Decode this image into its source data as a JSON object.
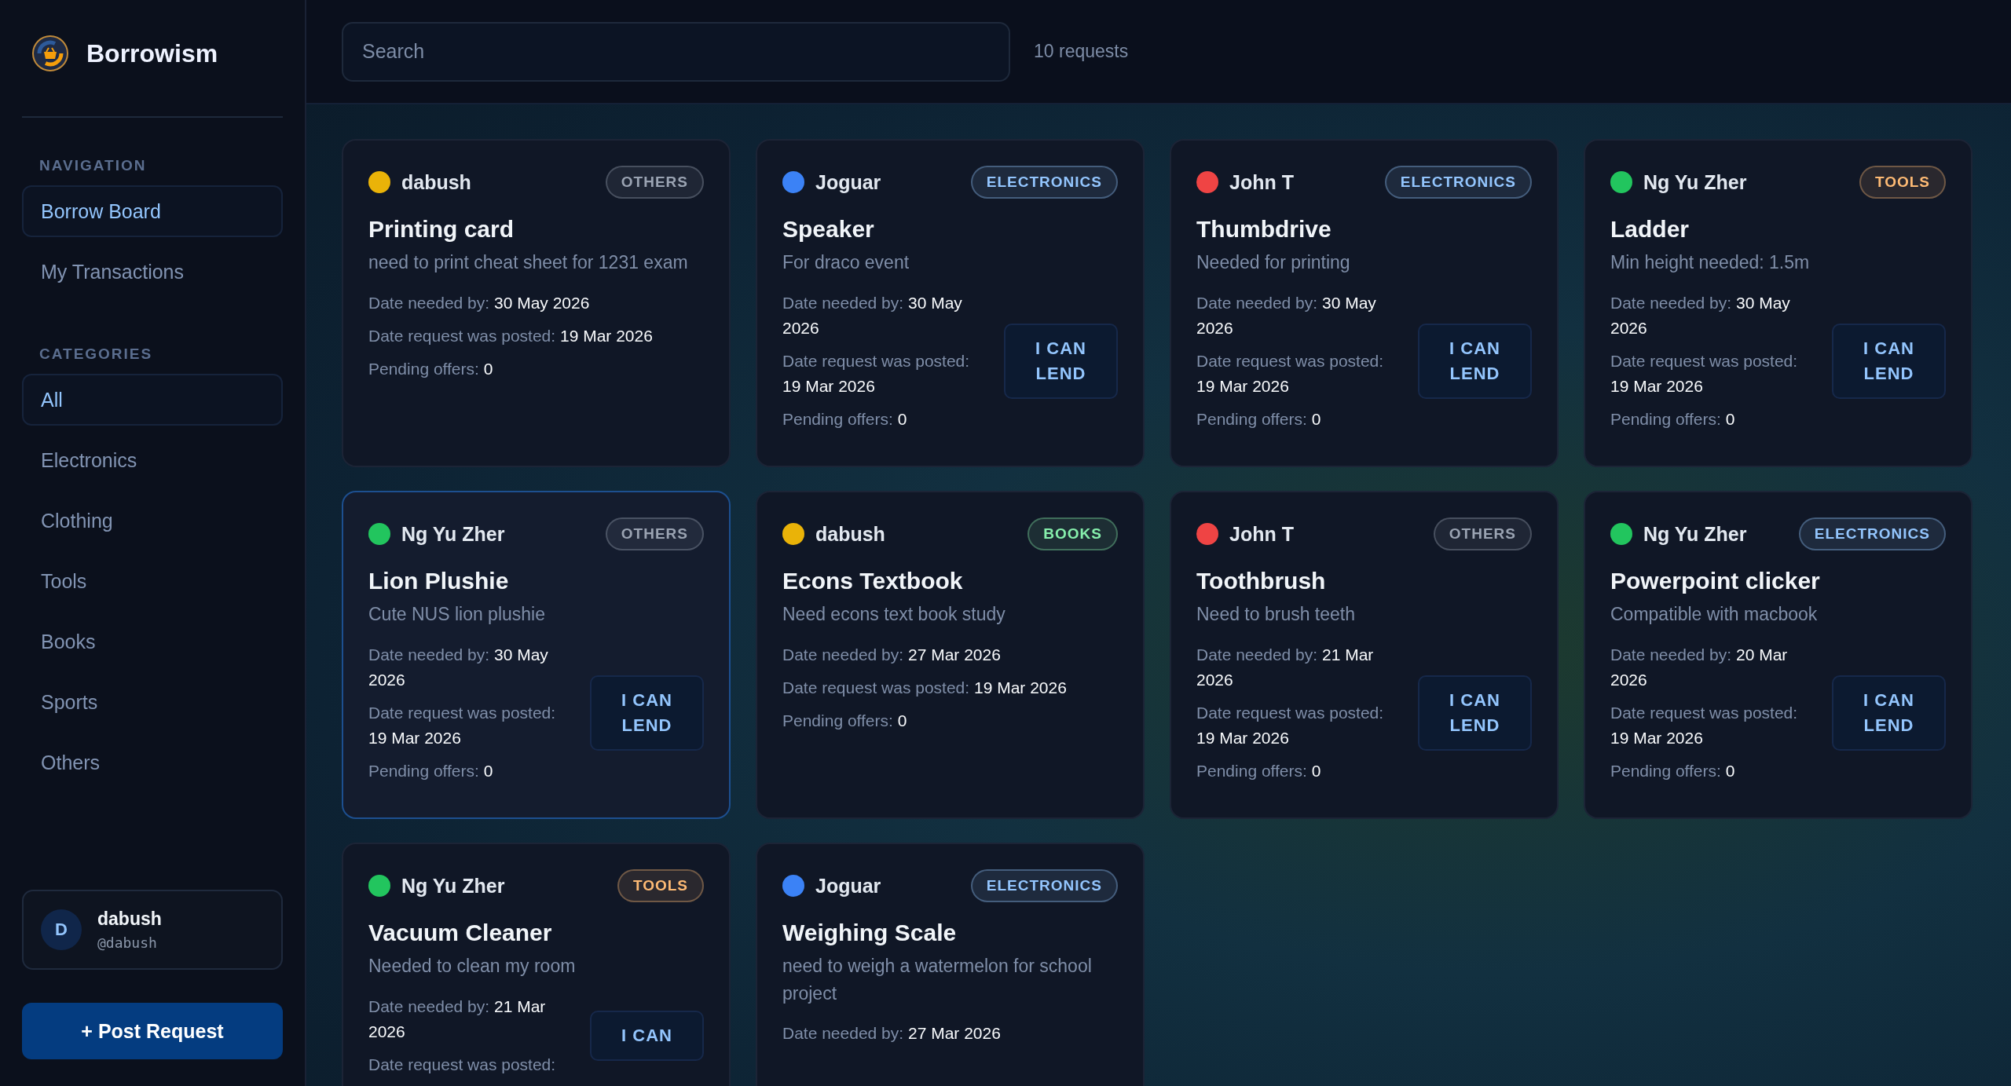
{
  "app": {
    "name": "Borrowism"
  },
  "sidebar": {
    "sections": [
      {
        "heading": "NAVIGATION",
        "items": [
          {
            "label": "Borrow Board",
            "selected": true
          },
          {
            "label": "My Transactions",
            "selected": false
          }
        ]
      },
      {
        "heading": "CATEGORIES",
        "items": [
          {
            "label": "All",
            "selected": true
          },
          {
            "label": "Electronics",
            "selected": false
          },
          {
            "label": "Clothing",
            "selected": false
          },
          {
            "label": "Tools",
            "selected": false
          },
          {
            "label": "Books",
            "selected": false
          },
          {
            "label": "Sports",
            "selected": false
          },
          {
            "label": "Others",
            "selected": false
          }
        ]
      }
    ],
    "user": {
      "initial": "D",
      "name": "dabush",
      "handle": "@dabush"
    },
    "post_button": "+ Post Request"
  },
  "search": {
    "placeholder": "Search"
  },
  "count": "10 requests",
  "requests": [
    {
      "user": "dabush",
      "color": "#eab308",
      "tag": {
        "label": "OTHERS",
        "color": "#9aa3b2"
      },
      "title": "Printing card",
      "description": "need to print cheat sheet for 1231 exam",
      "details": [
        "Date needed by: **30 May 2026**",
        "Date request was posted: **19 Mar 2026**",
        "Pending offers: **0**"
      ],
      "highlighted": false
    },
    {
      "user": "Joguar",
      "color": "#3b82f6",
      "tag": {
        "label": "ELECTRONICS",
        "color": "#93c5fd"
      },
      "title": "Speaker",
      "description": "For draco event",
      "details": [
        "Date needed by: **30 May 2026**",
        "Date request was posted: **19 Mar 2026**",
        "Pending offers: **0**"
      ],
      "lend_label": "I CAN LEND",
      "highlighted": false
    },
    {
      "user": "John T",
      "color": "#ef4444",
      "tag": {
        "label": "ELECTRONICS",
        "color": "#93c5fd"
      },
      "title": "Thumbdrive",
      "description": "Needed for printing",
      "details": [
        "Date needed by: **30 May 2026**",
        "Date request was posted: **19 Mar 2026**",
        "Pending offers: **0**"
      ],
      "lend_label": "I CAN LEND",
      "highlighted": false
    },
    {
      "user": "Ng Yu Zher",
      "color": "#22c55e",
      "tag": {
        "label": "TOOLS",
        "color": "#fdba74"
      },
      "title": "Ladder",
      "description": "Min height needed: 1.5m",
      "details": [
        "Date needed by: **30 May 2026**",
        "Date request was posted: **19 Mar 2026**",
        "Pending offers: **0**"
      ],
      "lend_label": "I CAN LEND",
      "highlighted": false
    },
    {
      "user": "Ng Yu Zher",
      "color": "#22c55e",
      "tag": {
        "label": "OTHERS",
        "color": "#9aa3b2"
      },
      "title": "Lion Plushie",
      "description": "Cute NUS lion plushie",
      "details": [
        "Date needed by: **30 May 2026**",
        "Date request was posted: **19 Mar 2026**",
        "Pending offers: **0**"
      ],
      "lend_label": "I CAN LEND",
      "highlighted": true
    },
    {
      "user": "dabush",
      "color": "#eab308",
      "tag": {
        "label": "BOOKS",
        "color": "#86efac"
      },
      "title": "Econs Textbook",
      "description": "Need econs text book study",
      "details": [
        "Date needed by: **27 Mar 2026**",
        "Date request was posted: **19 Mar 2026**",
        "Pending offers: **0**"
      ],
      "highlighted": false
    },
    {
      "user": "John T",
      "color": "#ef4444",
      "tag": {
        "label": "OTHERS",
        "color": "#9aa3b2"
      },
      "title": "Toothbrush",
      "description": "Need to brush teeth",
      "details": [
        "Date needed by: **21 Mar 2026**",
        "Date request was posted: **19 Mar 2026**",
        "Pending offers: **0**"
      ],
      "lend_label": "I CAN LEND",
      "highlighted": false
    },
    {
      "user": "Ng Yu Zher",
      "color": "#22c55e",
      "tag": {
        "label": "ELECTRONICS",
        "color": "#93c5fd"
      },
      "title": "Powerpoint clicker",
      "description": "Compatible with macbook",
      "details": [
        "Date needed by: **20 Mar 2026**",
        "Date request was posted: **19 Mar 2026**",
        "Pending offers: **0**"
      ],
      "lend_label": "I CAN LEND",
      "highlighted": false
    },
    {
      "user": "Ng Yu Zher",
      "color": "#22c55e",
      "tag": {
        "label": "TOOLS",
        "color": "#fdba74"
      },
      "title": "Vacuum Cleaner",
      "description": "Needed to clean my room",
      "details": [
        "Date needed by: **21 Mar 2026**",
        "Date request was posted:"
      ],
      "lend_label": "I CAN",
      "highlighted": false
    },
    {
      "user": "Joguar",
      "color": "#3b82f6",
      "tag": {
        "label": "ELECTRONICS",
        "color": "#93c5fd"
      },
      "title": "Weighing Scale",
      "description": "need to weigh a watermelon for school project",
      "details": [
        "Date needed by: **27 Mar 2026**"
      ],
      "highlighted": false
    }
  ]
}
